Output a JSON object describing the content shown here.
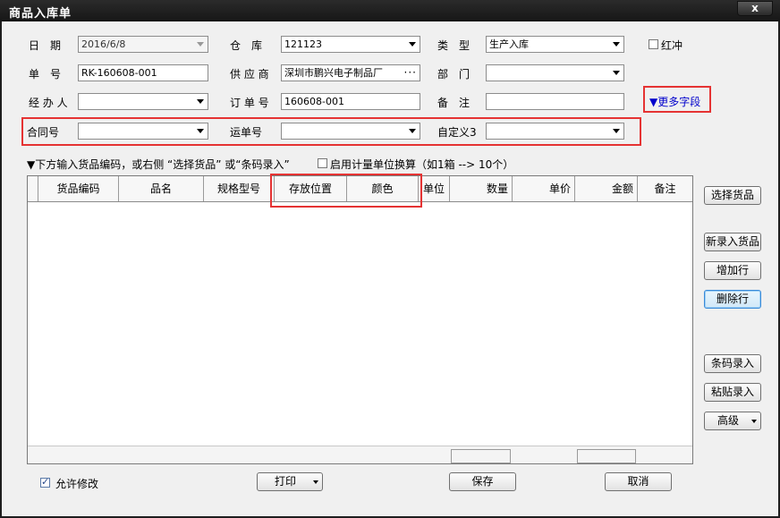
{
  "window": {
    "title": "商品入库单",
    "close_glyph": "x"
  },
  "form": {
    "date_label": "日　期",
    "date_value": "2016/6/8",
    "warehouse_label": "仓　库",
    "warehouse_value": "121123",
    "type_label": "类　型",
    "type_value": "生产入库",
    "red_flush_label": "红冲",
    "doc_no_label": "单　号",
    "doc_no_value": "RK-160608-001",
    "supplier_label": "供 应 商",
    "supplier_value": "深圳市鹏兴电子制品厂",
    "supplier_lookup": "···",
    "dept_label": "部　门",
    "dept_value": "",
    "handler_label": "经 办 人",
    "handler_value": "",
    "order_no_label": "订 单 号",
    "order_no_value": "160608-001",
    "remark_label": "备　注",
    "remark_value": "",
    "more_fields_label": "▼更多字段",
    "contract_label": "合同号",
    "contract_value": "",
    "waybill_label": "运单号",
    "waybill_value": "",
    "custom3_label": "自定义3",
    "custom3_value": ""
  },
  "hint": {
    "text": "▼下方输入货品编码，或右侧 “选择货品” 或“条码录入”",
    "unit_conversion_label": "启用计量单位换算（如1箱 --> 10个）"
  },
  "grid": {
    "columns": [
      "货品编码",
      "品名",
      "规格型号",
      "存放位置",
      "颜色",
      "单位",
      "数量",
      "单价",
      "金额",
      "备注"
    ]
  },
  "side_buttons": {
    "select_goods": "选择货品",
    "new_goods": "新录入货品",
    "add_row": "增加行",
    "delete_row": "删除行",
    "barcode_entry": "条码录入",
    "paste_entry": "粘贴录入",
    "advanced": "高级"
  },
  "bottom": {
    "allow_edit_label": "允许修改",
    "print_label": "打印",
    "save_label": "保存",
    "cancel_label": "取消"
  }
}
